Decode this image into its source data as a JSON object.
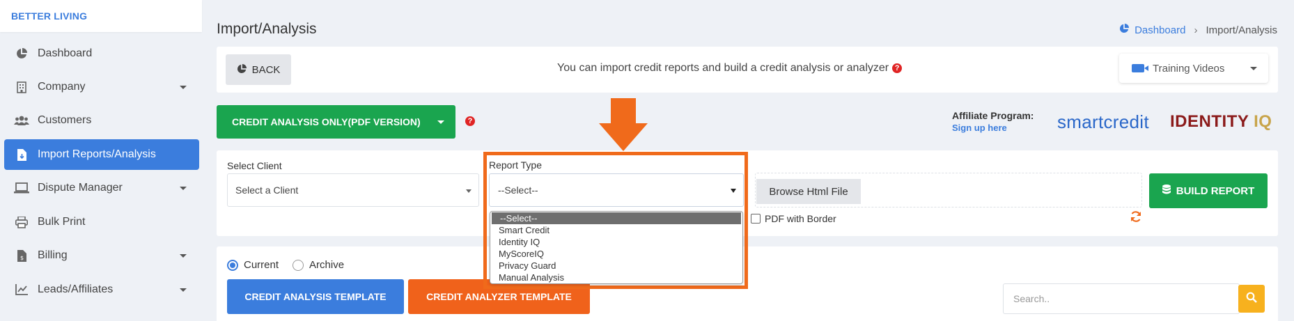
{
  "brand": "BETTER LIVING",
  "sidebar": {
    "items": [
      {
        "label": "Dashboard",
        "icon": "pie-chart-icon",
        "caret": false
      },
      {
        "label": "Company",
        "icon": "building-icon",
        "caret": true
      },
      {
        "label": "Customers",
        "icon": "users-icon",
        "caret": false
      },
      {
        "label": "Import Reports/Analysis",
        "icon": "file-import-icon",
        "caret": false,
        "active": true
      },
      {
        "label": "Dispute Manager",
        "icon": "laptop-icon",
        "caret": true
      },
      {
        "label": "Bulk Print",
        "icon": "printer-icon",
        "caret": false
      },
      {
        "label": "Billing",
        "icon": "invoice-icon",
        "caret": true
      },
      {
        "label": "Leads/Affiliates",
        "icon": "line-chart-icon",
        "caret": true
      }
    ]
  },
  "header": {
    "title": "Import/Analysis",
    "breadcrumb": {
      "home": "Dashboard",
      "current": "Import/Analysis"
    }
  },
  "topbar": {
    "back_label": "BACK",
    "info_text": "You can import credit reports and build a credit analysis or analyzer",
    "help_glyph": "?",
    "training_label": "Training Videos"
  },
  "credit_button": {
    "label": "CREDIT ANALYSIS ONLY(PDF VERSION)"
  },
  "affiliate": {
    "label": "Affiliate Program:",
    "signup": "Sign up here",
    "logo_smartcredit": "smartcredit",
    "logo_identity": "IDENTITY",
    "logo_iq": "IQ"
  },
  "form": {
    "client_label": "Select Client",
    "client_value": "Select a Client",
    "report_type_label": "Report Type",
    "report_type_value": "--Select--",
    "report_type_options": [
      "--Select--",
      "Smart Credit",
      "Identity IQ",
      "MyScoreIQ",
      "Privacy Guard",
      "Manual Analysis"
    ],
    "browse_label": "Browse Html File",
    "build_label": "BUILD REPORT",
    "pdf_border_label": "PDF with Border"
  },
  "templates": {
    "radio_current": "Current",
    "radio_archive": "Archive",
    "analysis_btn": "CREDIT ANALYSIS TEMPLATE",
    "analyzer_btn": "CREDIT ANALYZER TEMPLATE",
    "search_placeholder": "Search.."
  },
  "colors": {
    "accent": "#3b7ddd",
    "green": "#1aa54f",
    "orange": "#f06a1b",
    "search_button": "#f7b11e"
  }
}
